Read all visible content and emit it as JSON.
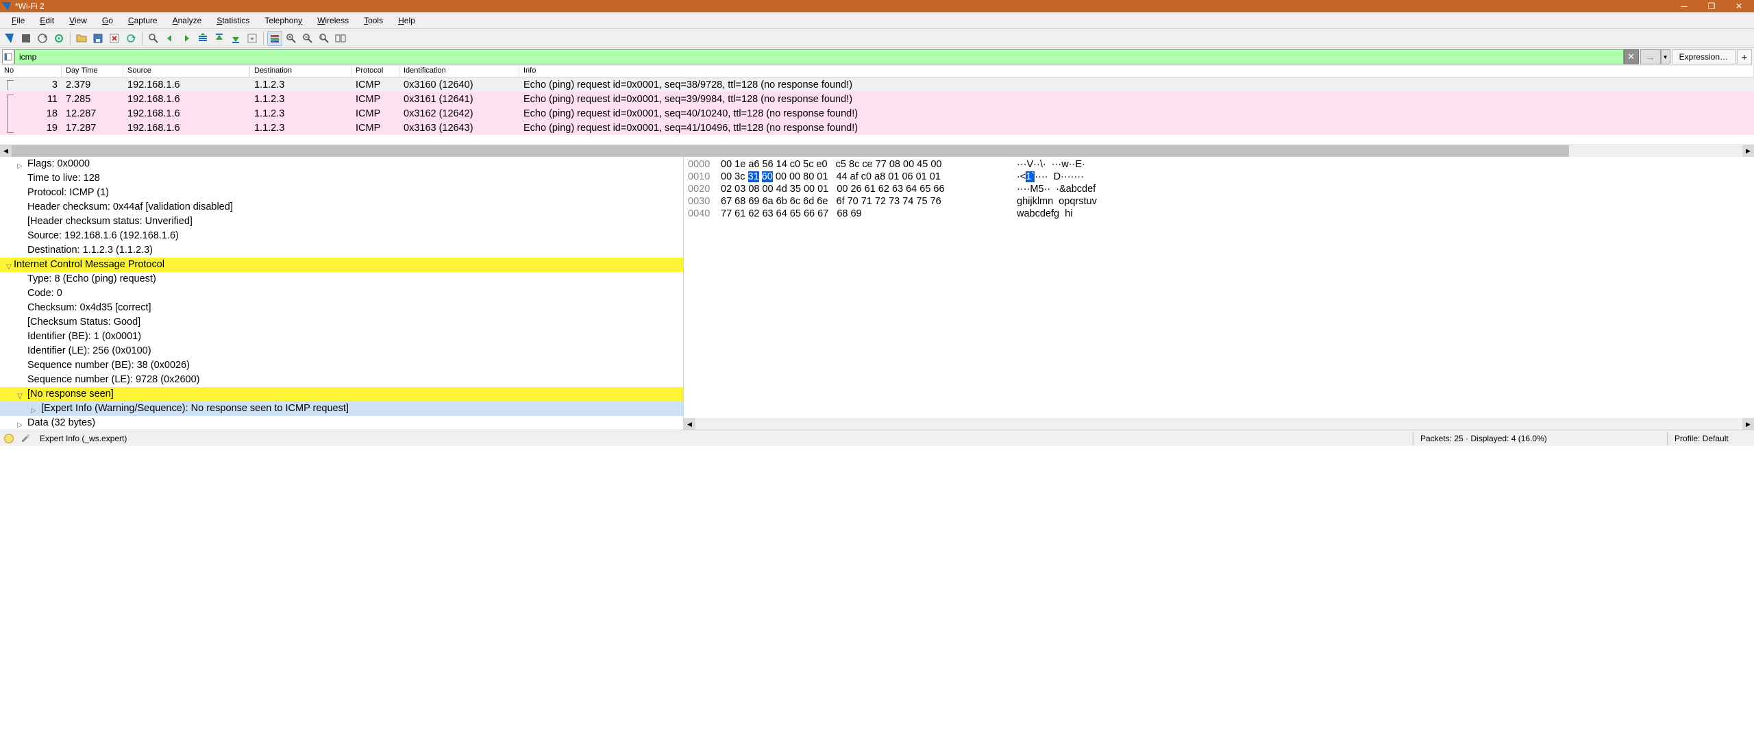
{
  "window": {
    "title": "*Wi-Fi 2"
  },
  "menu": {
    "file": "File",
    "edit": "Edit",
    "view": "View",
    "go": "Go",
    "capture": "Capture",
    "analyze": "Analyze",
    "statistics": "Statistics",
    "telephony": "Telephony",
    "wireless": "Wireless",
    "tools": "Tools",
    "help": "Help"
  },
  "filter": {
    "value": "icmp",
    "expression_label": "Expression…"
  },
  "columns": {
    "no": "No",
    "time": "Day Time",
    "src": "Source",
    "dst": "Destination",
    "proto": "Protocol",
    "ident": "Identification",
    "info": "Info"
  },
  "packets": [
    {
      "no": "3",
      "time": "2.379",
      "src": "192.168.1.6",
      "dst": "1.1.2.3",
      "proto": "ICMP",
      "ident": "0x3160 (12640)",
      "info": "Echo (ping) request  id=0x0001, seq=38/9728, ttl=128 (no response found!)",
      "cls": "r0"
    },
    {
      "no": "11",
      "time": "7.285",
      "src": "192.168.1.6",
      "dst": "1.1.2.3",
      "proto": "ICMP",
      "ident": "0x3161 (12641)",
      "info": "Echo (ping) request  id=0x0001, seq=39/9984, ttl=128 (no response found!)",
      "cls": "rp"
    },
    {
      "no": "18",
      "time": "12.287",
      "src": "192.168.1.6",
      "dst": "1.1.2.3",
      "proto": "ICMP",
      "ident": "0x3162 (12642)",
      "info": "Echo (ping) request  id=0x0001, seq=40/10240, ttl=128 (no response found!)",
      "cls": "rp"
    },
    {
      "no": "19",
      "time": "17.287",
      "src": "192.168.1.6",
      "dst": "1.1.2.3",
      "proto": "ICMP",
      "ident": "0x3163 (12643)",
      "info": "Echo (ping) request  id=0x0001, seq=41/10496, ttl=128 (no response found!)",
      "cls": "rp"
    }
  ],
  "details": [
    {
      "txt": "Flags: 0x0000",
      "tw": ">",
      "hl": ""
    },
    {
      "txt": "Time to live: 128",
      "tw": "",
      "hl": ""
    },
    {
      "txt": "Protocol: ICMP (1)",
      "tw": "",
      "hl": ""
    },
    {
      "txt": "Header checksum: 0x44af [validation disabled]",
      "tw": "",
      "hl": ""
    },
    {
      "txt": "[Header checksum status: Unverified]",
      "tw": "",
      "hl": ""
    },
    {
      "txt": "Source: 192.168.1.6 (192.168.1.6)",
      "tw": "",
      "hl": ""
    },
    {
      "txt": "Destination: 1.1.2.3 (1.1.2.3)",
      "tw": "",
      "hl": ""
    },
    {
      "txt": "Internet Control Message Protocol",
      "tw": "v",
      "hl": "y",
      "i": 1
    },
    {
      "txt": "Type: 8 (Echo (ping) request)",
      "tw": "",
      "hl": ""
    },
    {
      "txt": "Code: 0",
      "tw": "",
      "hl": ""
    },
    {
      "txt": "Checksum: 0x4d35 [correct]",
      "tw": "",
      "hl": ""
    },
    {
      "txt": "[Checksum Status: Good]",
      "tw": "",
      "hl": ""
    },
    {
      "txt": "Identifier (BE): 1 (0x0001)",
      "tw": "",
      "hl": ""
    },
    {
      "txt": "Identifier (LE): 256 (0x0100)",
      "tw": "",
      "hl": ""
    },
    {
      "txt": "Sequence number (BE): 38 (0x0026)",
      "tw": "",
      "hl": ""
    },
    {
      "txt": "Sequence number (LE): 9728 (0x2600)",
      "tw": "",
      "hl": ""
    },
    {
      "txt": "[No response seen]",
      "tw": "v",
      "hl": "y"
    },
    {
      "txt": "[Expert Info (Warning/Sequence): No response seen to ICMP request]",
      "tw": ">",
      "hl": "b",
      "i": 2
    },
    {
      "txt": "Data (32 bytes)",
      "tw": ">",
      "hl": ""
    }
  ],
  "hex": [
    {
      "off": "0000",
      "b": "00 1e a6 56 14 c0 5c e0  c5 8c ce 77 08 00 45 00",
      "a": "···V··\\·  ···w··E·"
    },
    {
      "off": "0010",
      "b": "00 3c 31 60 00 00 80 01  44 af c0 a8 01 06 01 01",
      "a": "·<1`····  D·······",
      "sel": [
        2,
        3
      ]
    },
    {
      "off": "0020",
      "b": "02 03 08 00 4d 35 00 01  00 26 61 62 63 64 65 66",
      "a": "····M5··  ·&abcdef"
    },
    {
      "off": "0030",
      "b": "67 68 69 6a 6b 6c 6d 6e  6f 70 71 72 73 74 75 76",
      "a": "ghijklmn  opqrstuv"
    },
    {
      "off": "0040",
      "b": "77 61 62 63 64 65 66 67  68 69",
      "a": "wabcdefg  hi"
    }
  ],
  "status": {
    "left": "Expert Info (_ws.expert)",
    "packets": "Packets: 25 · Displayed: 4 (16.0%)",
    "profile": "Profile: Default"
  }
}
